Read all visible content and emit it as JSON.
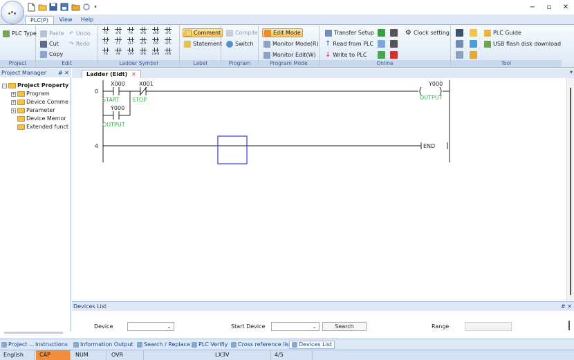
{
  "window": {
    "minimize": "−",
    "maximize": "▫",
    "close": "✕"
  },
  "tabs": [
    "PLC(P)",
    "View",
    "Help"
  ],
  "ribbon": {
    "project": {
      "label": "Project",
      "plc_type": "PLC Type"
    },
    "edit": {
      "label": "Edit",
      "paste": "Paste",
      "cut": "Cut",
      "copy": "Copy",
      "undo": "Undo",
      "redo": "Redo"
    },
    "ladder_symbol": {
      "label": "Ladder Symbol",
      "keys": [
        "F5",
        "sF6",
        "F9",
        "sF8",
        "aF8",
        "sF5",
        "F6",
        "F7",
        "sF7",
        "aF9",
        "sF9",
        "sF5",
        "F6",
        "F8",
        "cF9",
        "sF8",
        "caF8",
        "cF8"
      ]
    },
    "label": {
      "label": "Label",
      "comment": "Comment",
      "statement": "Statement"
    },
    "program": {
      "label": "Program",
      "compile": "Compile",
      "switch": "Switch"
    },
    "program_mode": {
      "label": "Program Mode",
      "edit_mode": "Edit Mode",
      "monitor_mode": "Monitor Mode(R)",
      "monitor_edit": "Monitor Edit(W)"
    },
    "online": {
      "label": "Online",
      "transfer_setup": "Transfer Setup",
      "read_from_plc": "Read from PLC",
      "write_to_plc": "Write to PLC",
      "clock_setting": "Clock setting"
    },
    "tool": {
      "label": "Tool",
      "plc_guide": "PLC Guide",
      "usb_download": "USB flash disk download"
    }
  },
  "project_manager": {
    "title": "Project Manager",
    "pin": "# ✕",
    "tree": [
      "Project Property",
      "Program",
      "Device Comme",
      "Parameter",
      "Device Memor",
      "Extended funct"
    ]
  },
  "doc_tab": {
    "label": "Ladder (Eidt)",
    "close": "✕"
  },
  "ladder": {
    "rung0_step": "0",
    "rung1_step": "4",
    "contact1_dev": "X000",
    "contact1_comment": "START",
    "contact2_dev": "X001",
    "contact2_comment": "STOP",
    "contact3_dev": "Y000",
    "contact3_comment": "OUTPUT",
    "coil_dev": "Y000",
    "coil_comment": "OUTPUT",
    "end_label": "END"
  },
  "devices_list": {
    "title": "Devices List",
    "pin": "# ✕",
    "device_label": "Device",
    "start_device_label": "Start Device",
    "search_button": "Search",
    "range_label": "Range"
  },
  "bottom_tabs": [
    "Project ...",
    "Instructions",
    "Information Output",
    "Search / Replace",
    "PLC Verifiy",
    "Cross reference list",
    "Devices List"
  ],
  "status": {
    "lang": "English",
    "cap": "CAP",
    "num": "NUM",
    "ovr": "OVR",
    "model": "LX3V",
    "pos": "4/5"
  },
  "colors": {
    "accent": "#15428b",
    "ladder_comment": "#2fb54a",
    "cursor": "#3b3bd6",
    "highlight": "#f9c35b"
  }
}
